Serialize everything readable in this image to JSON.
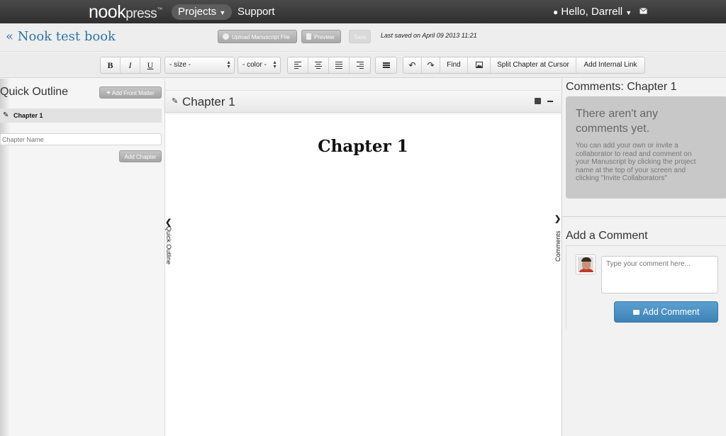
{
  "nav": {
    "logo_main": "nook",
    "logo_press": "press",
    "logo_tm": "™",
    "projects": "Projects",
    "support": "Support",
    "greeting": "Hello, Darrell",
    "user_icon": "user-icon",
    "mail_icon": "mail-icon"
  },
  "header": {
    "book_title": "« Nook test book",
    "upload_label": "Upload Manuscript File",
    "preview_label": "Preview",
    "save_label": "Save",
    "last_saved": "Last saved on April 09 2013 11:21"
  },
  "toolbar": {
    "bold": "B",
    "italic": "I",
    "underline": "U",
    "size_select": "- size -",
    "color_select": "- color -",
    "find": "Find",
    "split_chapter": "Split Chapter at Cursor",
    "add_internal_link": "Add Internal Link",
    "icons": [
      "align-left-icon",
      "align-center-icon",
      "align-justify-icon",
      "align-right-icon",
      "list-icon",
      "undo-icon",
      "redo-icon",
      "image-icon"
    ]
  },
  "outline": {
    "title": "Quick Outline",
    "add_front_matter": "Add Front Matter",
    "chapters": [
      "Chapter 1"
    ],
    "chapter_name_placeholder": "Chapter Name",
    "add_chapter": "Add Chapter",
    "tab_label": "Quick Outline"
  },
  "editor": {
    "chapter_header": "Chapter 1",
    "document_heading": "Chapter 1"
  },
  "comments": {
    "title": "Comments: Chapter 1",
    "empty_heading": "There aren't any comments yet.",
    "empty_text": "You can add your own or invite a collaborator to read and comment on your Manuscript by clicking the project name at the top of your screen and clicking \"Invite Collaborators\"",
    "add_title": "Add a Comment",
    "input_placeholder": "Type your comment here...",
    "add_button": "Add Comment",
    "tab_label": "Comments"
  },
  "colors": {
    "accent": "#2d76a8",
    "button_blue": "#4a90c4",
    "nav_bg": "#3a3a3a"
  }
}
